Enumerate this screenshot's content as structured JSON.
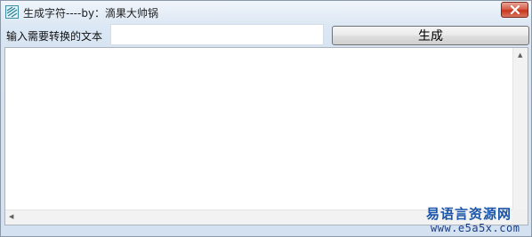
{
  "window": {
    "title": "生成字符----by：滴果大帅锅",
    "icon": "app-icon",
    "close_icon": "close-icon"
  },
  "form": {
    "input_label": "输入需要转换的文本",
    "input_value": "",
    "generate_label": "生成"
  },
  "output": {
    "value": ""
  },
  "watermark": {
    "name": "易语言资源网",
    "url": "www.e5a5x.com"
  },
  "colors": {
    "close_button": "#c7351c",
    "watermark": "#1a55a8"
  }
}
